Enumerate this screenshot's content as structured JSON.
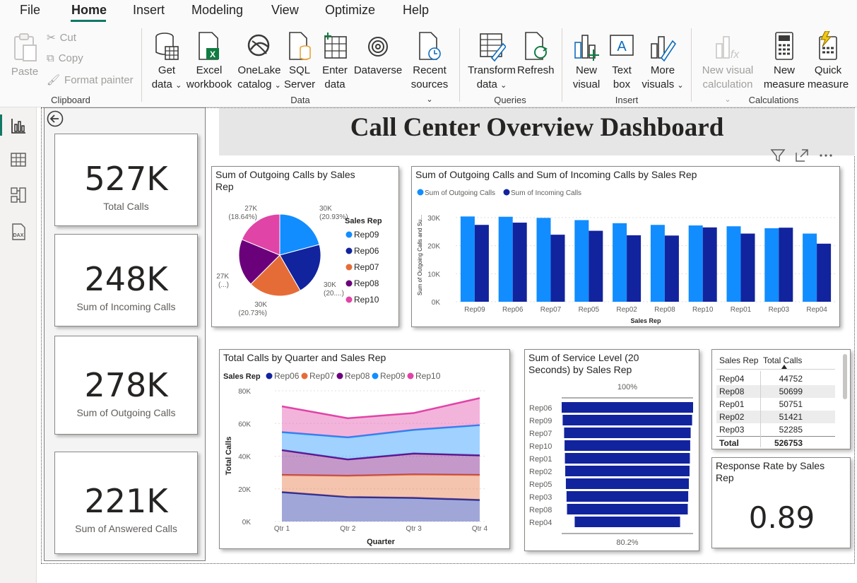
{
  "menu": {
    "items": [
      "File",
      "Home",
      "Insert",
      "Modeling",
      "View",
      "Optimize",
      "Help"
    ],
    "active": "Home"
  },
  "ribbon": {
    "clipboard": {
      "paste": "Paste",
      "cut": "Cut",
      "copy": "Copy",
      "format_painter": "Format painter",
      "group": "Clipboard"
    },
    "data": {
      "get_data": [
        "Get",
        "data"
      ],
      "excel": [
        "Excel",
        "workbook"
      ],
      "onelake": [
        "OneLake",
        "catalog"
      ],
      "sql": [
        "SQL",
        "Server"
      ],
      "enter": [
        "Enter",
        "data"
      ],
      "dataverse": "Dataverse",
      "recent": [
        "Recent",
        "sources"
      ],
      "group": "Data"
    },
    "queries": {
      "transform": [
        "Transform",
        "data"
      ],
      "refresh": "Refresh",
      "group": "Queries"
    },
    "insert": {
      "new_visual": [
        "New",
        "visual"
      ],
      "text_box": [
        "Text",
        "box"
      ],
      "more_visuals": [
        "More",
        "visuals"
      ],
      "group": "Insert"
    },
    "calculations": {
      "new_visual_calc": [
        "New visual",
        "calculation"
      ],
      "new_measure": [
        "New",
        "measure"
      ],
      "quick_measure": [
        "Quick",
        "measure"
      ],
      "group": "Calculations"
    }
  },
  "report": {
    "title": "Call Center Overview Dashboard",
    "kpis": [
      {
        "value": "527K",
        "label": "Total Calls"
      },
      {
        "value": "248K",
        "label": "Sum of Incoming Calls"
      },
      {
        "value": "278K",
        "label": "Sum of Outgoing Calls"
      },
      {
        "value": "221K",
        "label": "Sum of Answered Calls"
      }
    ],
    "table": {
      "headers": [
        "Sales Rep",
        "Total Calls"
      ],
      "rows": [
        [
          "Rep04",
          "44752"
        ],
        [
          "Rep08",
          "50699"
        ],
        [
          "Rep01",
          "50751"
        ],
        [
          "Rep02",
          "51421"
        ],
        [
          "Rep03",
          "52285"
        ]
      ],
      "total": [
        "Total",
        "526753"
      ]
    },
    "response_rate": {
      "title": "Response Rate by Sales Rep",
      "value": "0.89"
    }
  },
  "colors": {
    "accent": "#117865",
    "rep09": "#118DFF",
    "rep06": "#12239E",
    "rep07": "#E66C37",
    "rep08": "#6B007B",
    "rep10": "#E044A7"
  },
  "chart_data": [
    {
      "type": "pie",
      "title": "Sum of Outgoing Calls by Sales Rep",
      "legend_title": "Sales Rep",
      "legend_position": "right",
      "categories": [
        "Rep09",
        "Rep06",
        "Rep07",
        "Rep08",
        "Rep10"
      ],
      "values": [
        30,
        30,
        30,
        27,
        27
      ],
      "percents": [
        20.93,
        20.9,
        20.73,
        18.8,
        18.64
      ],
      "labels": [
        [
          "30K",
          "(20.93%)"
        ],
        [
          "30K",
          "(20....)"
        ],
        [
          "30K",
          "(20.73%)"
        ],
        [
          "27K",
          "(...)"
        ],
        [
          "27K",
          "(18.64%)"
        ]
      ],
      "colors": [
        "#118DFF",
        "#12239E",
        "#E66C37",
        "#6B007B",
        "#E044A7"
      ]
    },
    {
      "type": "bar",
      "title": "Sum of Outgoing Calls and Sum of Incoming Calls by Sales Rep",
      "xlabel": "Sales Rep",
      "ylabel": "Sum of Outgoing Calls and Su...",
      "categories": [
        "Rep09",
        "Rep06",
        "Rep07",
        "Rep05",
        "Rep02",
        "Rep08",
        "Rep10",
        "Rep01",
        "Rep03",
        "Rep04"
      ],
      "series": [
        {
          "name": "Sum of Outgoing Calls",
          "values": [
            30400,
            30300,
            29900,
            29100,
            28000,
            27400,
            27200,
            26900,
            26200,
            24300
          ],
          "color": "#118DFF"
        },
        {
          "name": "Sum of Incoming Calls",
          "values": [
            27400,
            28200,
            23900,
            25300,
            23700,
            23600,
            26500,
            24300,
            26400,
            20700
          ],
          "color": "#12239E"
        }
      ],
      "yticks": [
        "0K",
        "10K",
        "20K",
        "30K"
      ],
      "ylim": [
        0,
        33000
      ],
      "legend_position": "top-left"
    },
    {
      "type": "area",
      "title": "Total Calls by Quarter and Sales Rep",
      "legend_title": "Sales Rep",
      "xlabel": "Quarter",
      "ylabel": "Total Calls",
      "categories": [
        "Qtr 1",
        "Qtr 2",
        "Qtr 3",
        "Qtr 4"
      ],
      "stacked": true,
      "series": [
        {
          "name": "Rep06",
          "values": [
            18000,
            15000,
            14500,
            13200
          ],
          "color": "#12239E"
        },
        {
          "name": "Rep07",
          "values": [
            10500,
            13000,
            14300,
            15300
          ],
          "color": "#E66C37"
        },
        {
          "name": "Rep08",
          "values": [
            15200,
            10000,
            12800,
            12000
          ],
          "color": "#6B007B"
        },
        {
          "name": "Rep09",
          "values": [
            11000,
            13500,
            14500,
            18500
          ],
          "color": "#118DFF"
        },
        {
          "name": "Rep10",
          "values": [
            15800,
            11700,
            10300,
            16500
          ],
          "color": "#E044A7"
        }
      ],
      "yticks": [
        "0K",
        "20K",
        "40K",
        "60K",
        "80K"
      ],
      "ylim": [
        0,
        80000
      ],
      "legend_position": "top-left"
    },
    {
      "type": "bar",
      "orientation": "horizontal",
      "title": "Sum of Service Level (20 Seconds) by Sales Rep",
      "categories": [
        "Rep06",
        "Rep09",
        "Rep07",
        "Rep10",
        "Rep01",
        "Rep02",
        "Rep05",
        "Rep03",
        "Rep08",
        "Rep04"
      ],
      "values": [
        100,
        98.5,
        96.3,
        95.6,
        95.1,
        94.6,
        93.6,
        92.6,
        91.9,
        80.2
      ],
      "top_label": "100%",
      "bottom_label": "80.2%",
      "color": "#12239E"
    }
  ]
}
